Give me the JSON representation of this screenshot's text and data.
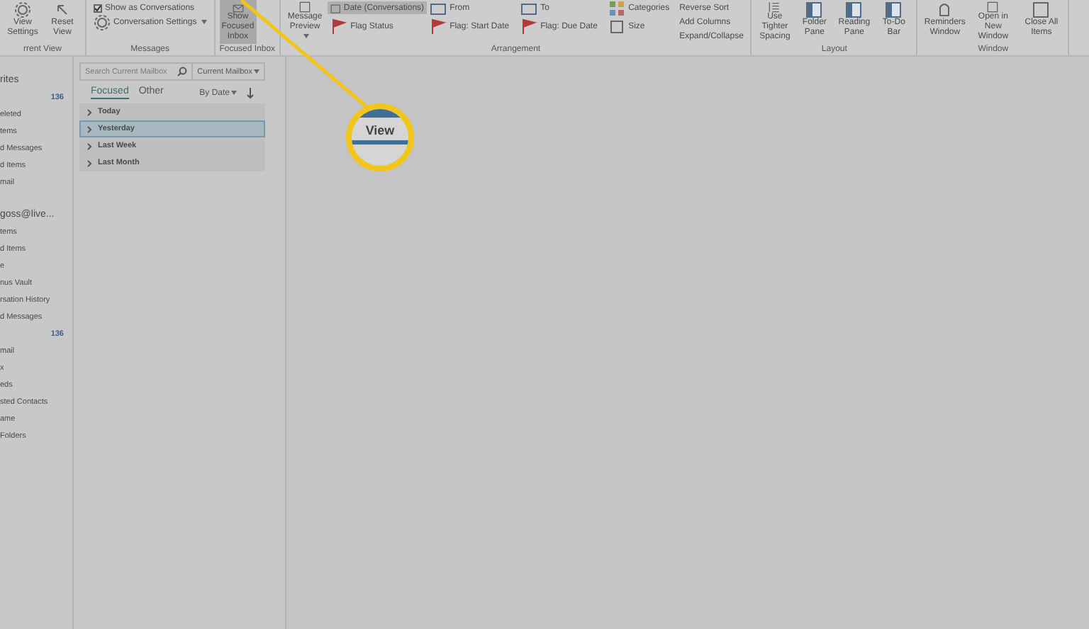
{
  "ribbon": {
    "groups": [
      {
        "kind": "big",
        "label": "rrent View",
        "buttons": [
          {
            "label": "View Settings",
            "selected": false
          },
          {
            "label": "Reset View",
            "selected": false
          }
        ]
      },
      {
        "kind": "list",
        "label": "Messages",
        "items": [
          {
            "kind": "checkbox",
            "label": "Show as Conversations",
            "checked": true
          },
          {
            "kind": "dropdown",
            "label": "Conversation Settings"
          }
        ]
      },
      {
        "kind": "big",
        "label": "Focused Inbox",
        "buttons": [
          {
            "label": "Show Focused Inbox",
            "selected": true
          }
        ]
      },
      {
        "kind": "arrange",
        "label": "Arrangement",
        "preview": "Message Preview",
        "cells": [
          {
            "label": "Date (Conversations)",
            "selected": true
          },
          {
            "label": "From",
            "selected": false
          },
          {
            "label": "To",
            "selected": false
          },
          {
            "label": "Categories",
            "selected": false
          },
          {
            "label": "Flag Status",
            "selected": false
          },
          {
            "label": "Flag: Start Date",
            "selected": false
          },
          {
            "label": "Flag: Due Date",
            "selected": false
          },
          {
            "label": "Size",
            "selected": false
          }
        ],
        "options": [
          "Reverse Sort",
          "Add Columns",
          "Expand/Collapse"
        ]
      },
      {
        "kind": "big",
        "label": "Layout",
        "buttons": [
          {
            "label": "Use Tighter Spacing",
            "selected": false
          },
          {
            "label": "Folder Pane",
            "selected": false
          },
          {
            "label": "Reading Pane",
            "selected": false
          },
          {
            "label": "To-Do Bar",
            "selected": false
          }
        ]
      },
      {
        "kind": "big",
        "label": "Window",
        "buttons": [
          {
            "label": "Reminders Window",
            "selected": false
          },
          {
            "label": "Open in New Window",
            "selected": false
          },
          {
            "label": "Close All Items",
            "selected": false
          }
        ]
      }
    ]
  },
  "folders": {
    "sections": [
      {
        "title": "rites",
        "items": [
          {
            "count": "136"
          },
          {
            "name": "eleted"
          },
          {
            "name": "tems"
          },
          {
            "name": "d Messages"
          },
          {
            "name": "d Items"
          },
          {
            "name": "mail"
          }
        ]
      },
      {
        "title": "goss@live...",
        "items": [
          {
            "name": "tems"
          },
          {
            "name": "d Items"
          },
          {
            "name": "e"
          },
          {
            "name": "nus Vault"
          },
          {
            "name": "rsation History"
          },
          {
            "name": "d Messages"
          },
          {
            "count": "136"
          },
          {
            "name": "mail"
          },
          {
            "name": "x"
          },
          {
            "name": "eds"
          },
          {
            "name": "sted Contacts"
          },
          {
            "name": "ame"
          },
          {
            "name": "Folders"
          }
        ]
      }
    ]
  },
  "message_list": {
    "search": {
      "placeholder": "Search Current Mailbox"
    },
    "scope": "Current Mailbox",
    "tabs": [
      {
        "label": "Focused",
        "selected": true
      },
      {
        "label": "Other",
        "selected": false
      }
    ],
    "sort": "By Date",
    "groups": [
      {
        "label": "Today",
        "selected": false
      },
      {
        "label": "Yesterday",
        "selected": true
      },
      {
        "label": "Last Week",
        "selected": false
      },
      {
        "label": "Last Month",
        "selected": false
      }
    ]
  },
  "callout": {
    "label": "View"
  }
}
